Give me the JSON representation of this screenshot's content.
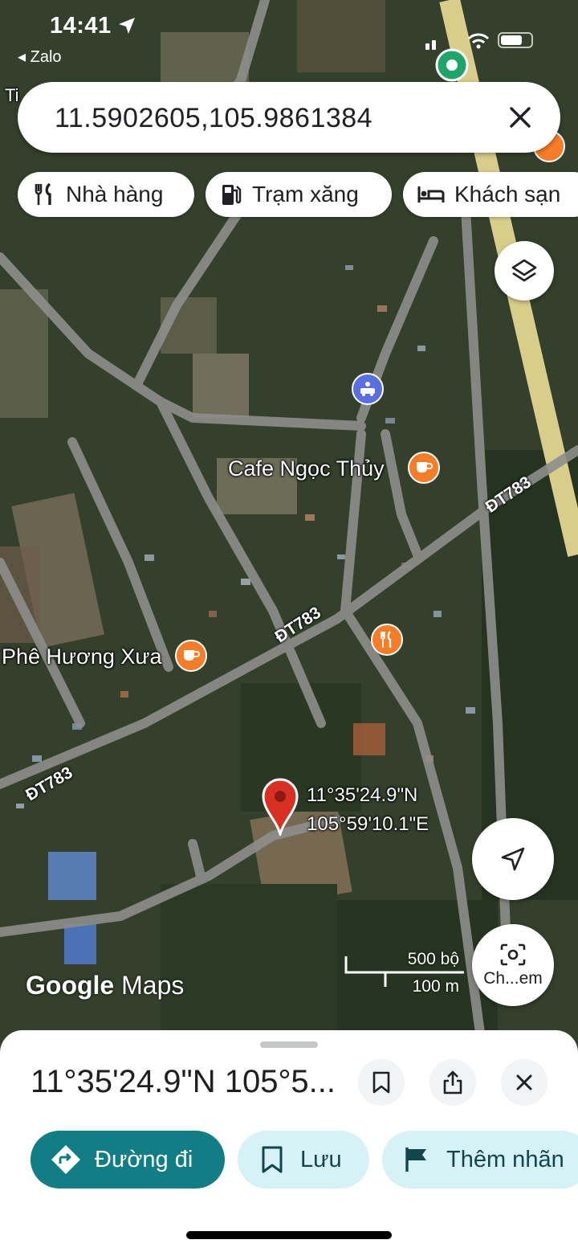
{
  "status_bar": {
    "time": "14:41",
    "back_app": "Zalo"
  },
  "search": {
    "query": "11.5902605,105.9861384"
  },
  "chips": [
    {
      "label": "Nhà hàng",
      "icon": "restaurant-icon"
    },
    {
      "label": "Trạm xăng",
      "icon": "gas-station-icon"
    },
    {
      "label": "Khách sạn",
      "icon": "hotel-icon"
    }
  ],
  "map": {
    "pin_lat": "11°35'24.9\"N",
    "pin_lng": "105°59'10.1\"E",
    "places": {
      "cafe1": "Cafe Ngọc Thủy",
      "cafe2": "Phê Hương Xưa"
    },
    "roads": {
      "r1": "ĐT783",
      "r2": "ĐT783",
      "r3": "ĐT783"
    },
    "top_left_fragment": "Ti",
    "logo_google": "Google",
    "logo_maps": "Maps",
    "scale_top": "500 bộ",
    "scale_bottom": "100 m",
    "lens_label": "Ch...em"
  },
  "sheet": {
    "title": "11°35'24.9\"N 105°5...",
    "actions": {
      "directions": "Đường đi",
      "save": "Lưu",
      "label": "Thêm nhãn"
    }
  },
  "colors": {
    "accent": "#137d85",
    "secondary_bg": "#d6f2f7",
    "pin": "#d93025",
    "cafe_poi": "#f57c28",
    "transit_poi": "#5a6ee0"
  }
}
